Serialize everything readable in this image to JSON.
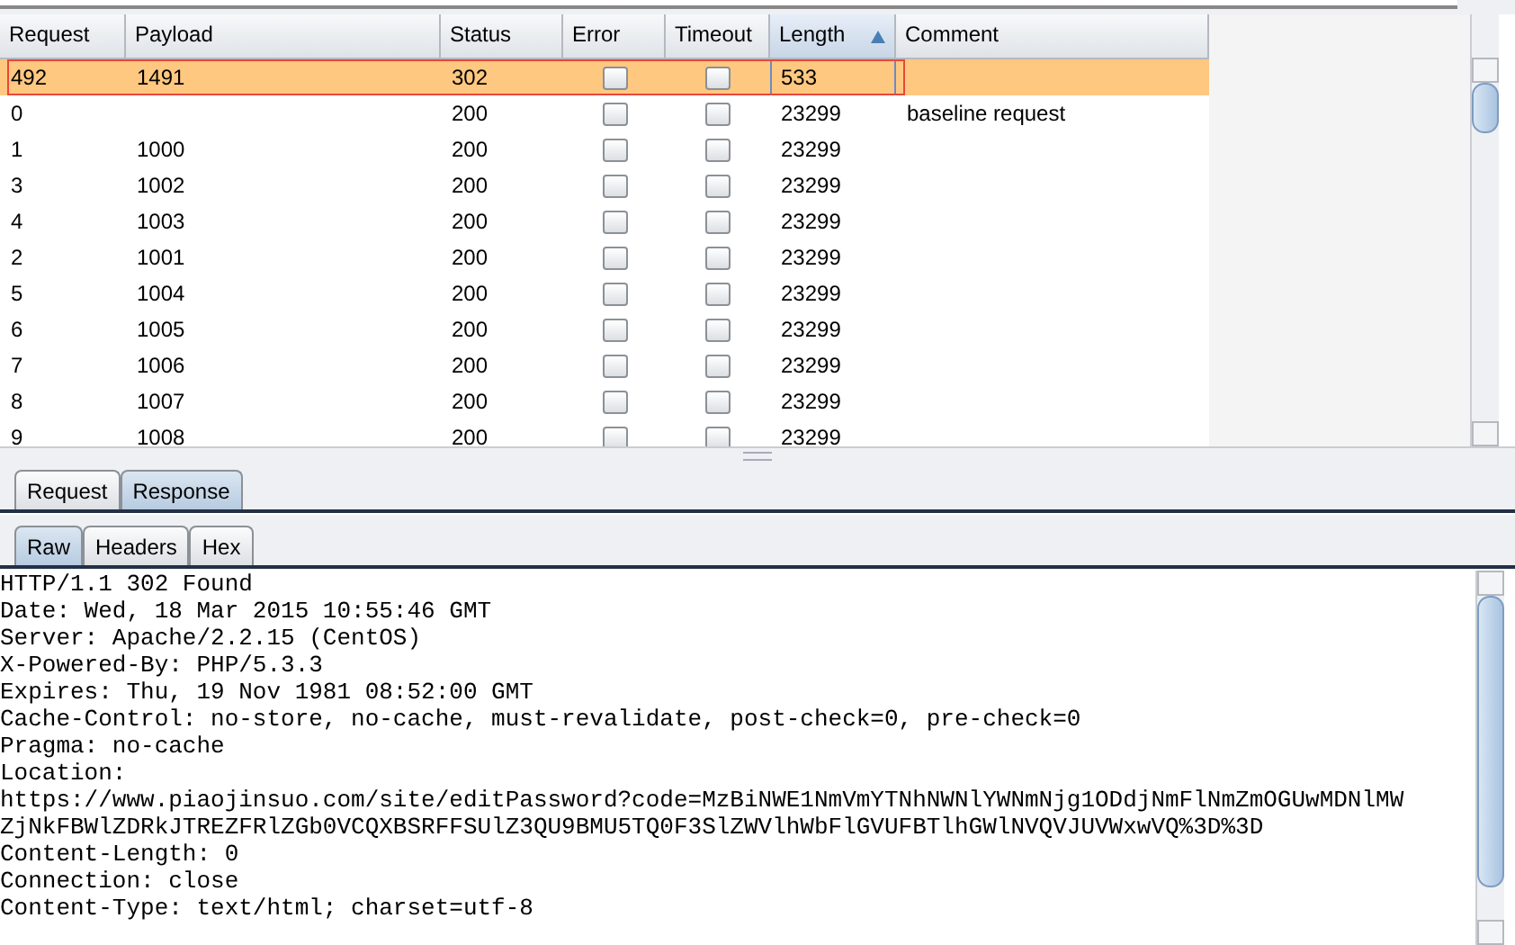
{
  "table": {
    "columns": [
      {
        "label": "Request",
        "sorted": false
      },
      {
        "label": "Payload",
        "sorted": false
      },
      {
        "label": "Status",
        "sorted": false
      },
      {
        "label": "Error",
        "sorted": false
      },
      {
        "label": "Timeout",
        "sorted": false
      },
      {
        "label": "Length",
        "sorted": true
      },
      {
        "label": "Comment",
        "sorted": false
      }
    ],
    "rows": [
      {
        "request": "492",
        "payload": "1491",
        "status": "302",
        "error": false,
        "timeout": false,
        "length": "533",
        "comment": "",
        "selected": true
      },
      {
        "request": "0",
        "payload": "",
        "status": "200",
        "error": false,
        "timeout": false,
        "length": "23299",
        "comment": "baseline request",
        "selected": false
      },
      {
        "request": "1",
        "payload": "1000",
        "status": "200",
        "error": false,
        "timeout": false,
        "length": "23299",
        "comment": "",
        "selected": false
      },
      {
        "request": "3",
        "payload": "1002",
        "status": "200",
        "error": false,
        "timeout": false,
        "length": "23299",
        "comment": "",
        "selected": false
      },
      {
        "request": "4",
        "payload": "1003",
        "status": "200",
        "error": false,
        "timeout": false,
        "length": "23299",
        "comment": "",
        "selected": false
      },
      {
        "request": "2",
        "payload": "1001",
        "status": "200",
        "error": false,
        "timeout": false,
        "length": "23299",
        "comment": "",
        "selected": false
      },
      {
        "request": "5",
        "payload": "1004",
        "status": "200",
        "error": false,
        "timeout": false,
        "length": "23299",
        "comment": "",
        "selected": false
      },
      {
        "request": "6",
        "payload": "1005",
        "status": "200",
        "error": false,
        "timeout": false,
        "length": "23299",
        "comment": "",
        "selected": false
      },
      {
        "request": "7",
        "payload": "1006",
        "status": "200",
        "error": false,
        "timeout": false,
        "length": "23299",
        "comment": "",
        "selected": false
      },
      {
        "request": "8",
        "payload": "1007",
        "status": "200",
        "error": false,
        "timeout": false,
        "length": "23299",
        "comment": "",
        "selected": false
      },
      {
        "request": "9",
        "payload": "1008",
        "status": "200",
        "error": false,
        "timeout": false,
        "length": "23299",
        "comment": "",
        "selected": false
      }
    ]
  },
  "message_tabs": [
    {
      "label": "Request",
      "selected": false
    },
    {
      "label": "Response",
      "selected": true
    }
  ],
  "view_tabs": [
    {
      "label": "Raw",
      "selected": true
    },
    {
      "label": "Headers",
      "selected": false
    },
    {
      "label": "Hex",
      "selected": false
    }
  ],
  "response_lines": [
    "HTTP/1.1 302 Found",
    "Date: Wed, 18 Mar 2015 10:55:46 GMT",
    "Server: Apache/2.2.15 (CentOS)",
    "X-Powered-By: PHP/5.3.3",
    "Expires: Thu, 19 Nov 1981 08:52:00 GMT",
    "Cache-Control: no-store, no-cache, must-revalidate, post-check=0, pre-check=0",
    "Pragma: no-cache",
    "Location:",
    "https://www.piaojinsuo.com/site/editPassword?code=MzBiNWE1NmVmYTNhNWNlYWNmNjg1ODdjNmFlNmZmOGUwMDNlMW",
    "ZjNkFBWlZDRkJTREZFRlZGb0VCQXBSRFFSUlZ3QU9BMU5TQ0F3SlZWVlhWbFlGVUFBTlhGWlNVQVJUVWxwVQ%3D%3D",
    "Content-Length: 0",
    "Connection: close",
    "Content-Type: text/html; charset=utf-8"
  ]
}
